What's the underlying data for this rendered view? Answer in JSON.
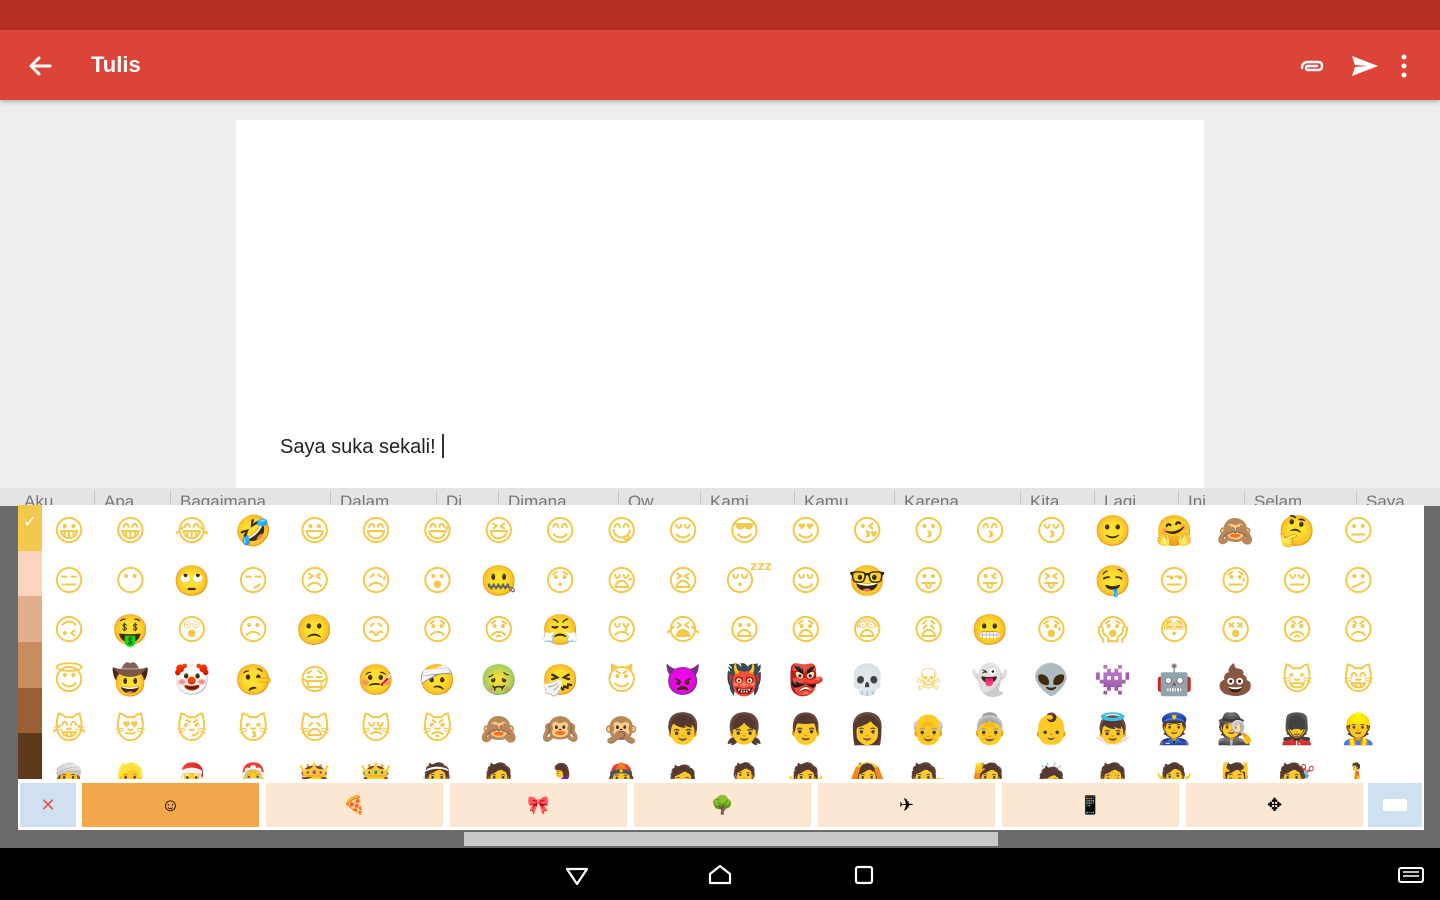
{
  "app_bar": {
    "title": "Tulis"
  },
  "compose": {
    "body_text": "Saya suka sekali!"
  },
  "suggestions": [
    "Aku",
    "Apa",
    "Bagaimana",
    "Dalam",
    "Di",
    "Dimana",
    "Ow",
    "Kami",
    "Kamu",
    "Karena",
    "Kita",
    "Lagi",
    "Ini",
    "Selam",
    "Saya"
  ],
  "colors": {
    "status_bar": "#b52e22",
    "app_bar": "#db4437",
    "emoji_yellow": "#f2c94c",
    "active_category": "#f2a74a",
    "category_bg": "#fce8d2"
  },
  "skin_tones": [
    "#f2c94c",
    "#fbd4bd",
    "#e2ae8e",
    "#c98c5e",
    "#9a5f34",
    "#5e3a1d"
  ],
  "emoji_rows": [
    [
      "😀",
      "😁",
      "😂",
      "🤣",
      "😃",
      "😄",
      "😅",
      "😆",
      "😊",
      "😋",
      "😌",
      "😎",
      "😍",
      "😘",
      "😗",
      "😙",
      "😚",
      "🙂",
      "🤗",
      "🙈",
      "🤔",
      "😐"
    ],
    [
      "😑",
      "😶",
      "🙄",
      "😏",
      "😣",
      "😥",
      "😮",
      "🤐",
      "😯",
      "😪",
      "😫",
      "😴",
      "😌",
      "🤓",
      "😛",
      "😜",
      "😝",
      "🤤",
      "😒",
      "😓",
      "😔",
      "😕"
    ],
    [
      "🙃",
      "🤑",
      "😲",
      "☹",
      "🙁",
      "😖",
      "😞",
      "😟",
      "😤",
      "😢",
      "😭",
      "😦",
      "😧",
      "😨",
      "😩",
      "😬",
      "😰",
      "😱",
      "😳",
      "😵",
      "😡",
      "😠"
    ],
    [
      "😇",
      "🤠",
      "🤡",
      "🤥",
      "😷",
      "🤒",
      "🤕",
      "🤢",
      "🤧",
      "😈",
      "👿",
      "👹",
      "👺",
      "💀",
      "☠",
      "👻",
      "👽",
      "👾",
      "🤖",
      "💩",
      "😺",
      "😸"
    ],
    [
      "😹",
      "😻",
      "😼",
      "😽",
      "🙀",
      "😿",
      "😾",
      "🙈",
      "🙉",
      "🙊",
      "👦",
      "👧",
      "👨",
      "👩",
      "👴",
      "👵",
      "👶",
      "👼",
      "👮",
      "🕵",
      "💂",
      "👷"
    ],
    [
      "👳",
      "👱",
      "🎅",
      "🤶",
      "👸",
      "🤴",
      "👰",
      "🤵",
      "🤰",
      "👲",
      "🙍",
      "🙎",
      "🙅",
      "🙆",
      "💁",
      "🙋",
      "🙇",
      "🤦",
      "🤷",
      "💆",
      "💇",
      "🚶"
    ]
  ],
  "categories": [
    {
      "name": "smileys",
      "glyph": "☺"
    },
    {
      "name": "food",
      "glyph": "🍕"
    },
    {
      "name": "objects",
      "glyph": "🎀"
    },
    {
      "name": "nature",
      "glyph": "🌳"
    },
    {
      "name": "travel",
      "glyph": "✈"
    },
    {
      "name": "phone",
      "glyph": "📱"
    },
    {
      "name": "symbols",
      "glyph": "✥"
    }
  ],
  "keyboard": {
    "close_glyph": "✕"
  }
}
